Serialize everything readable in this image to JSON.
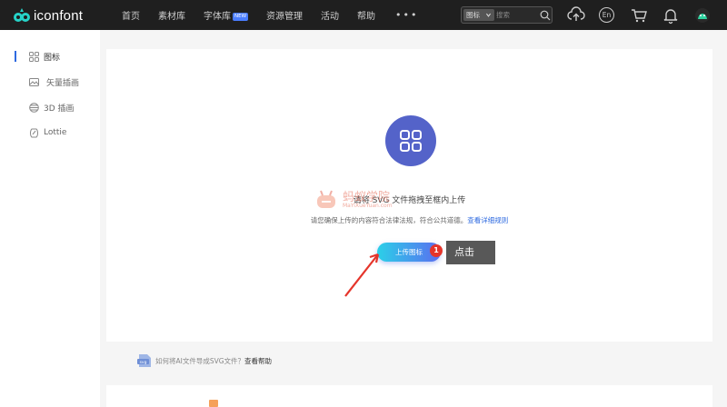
{
  "header": {
    "logo_text": "iconfont",
    "nav": [
      {
        "label": "首页"
      },
      {
        "label": "素材库"
      },
      {
        "label": "字体库",
        "badge": "NEW"
      },
      {
        "label": "资源管理"
      },
      {
        "label": "活动"
      },
      {
        "label": "帮助"
      }
    ],
    "more_label": "•••",
    "search": {
      "type_label": "图标",
      "placeholder": "搜索"
    },
    "icons": [
      "upload-cloud-icon",
      "language-en-icon",
      "cart-icon",
      "bell-icon",
      "avatar"
    ],
    "language_label": "En"
  },
  "sidebar": {
    "items": [
      {
        "label": "图标",
        "icon": "grid-icon",
        "active": true
      },
      {
        "label": "矢量插画",
        "icon": "image-icon",
        "active": false
      },
      {
        "label": "3D 插画",
        "icon": "3d-icon",
        "active": false
      },
      {
        "label": "Lottie",
        "icon": "lottie-icon",
        "active": false
      }
    ]
  },
  "main": {
    "upload_hint": "请将 SVG 文件拖拽至框内上传",
    "legal_text": "请您确保上传的内容符合法律法规，符合公共道德。",
    "legal_link": "查看详细规则",
    "upload_button": "上传图标"
  },
  "annotation": {
    "step_number": "1",
    "callout": "点击"
  },
  "watermark": {
    "text": "蚂蚁学院",
    "sub": "MaYiXueYuan.com"
  },
  "help": {
    "text": "如何将AI文件导成SVG文件？",
    "link": "查看帮助"
  },
  "colors": {
    "topbar": "#1f1f1f",
    "accent": "#2e6ae0",
    "upload_circle": "#5463c9",
    "annotation_red": "#e5352b"
  }
}
